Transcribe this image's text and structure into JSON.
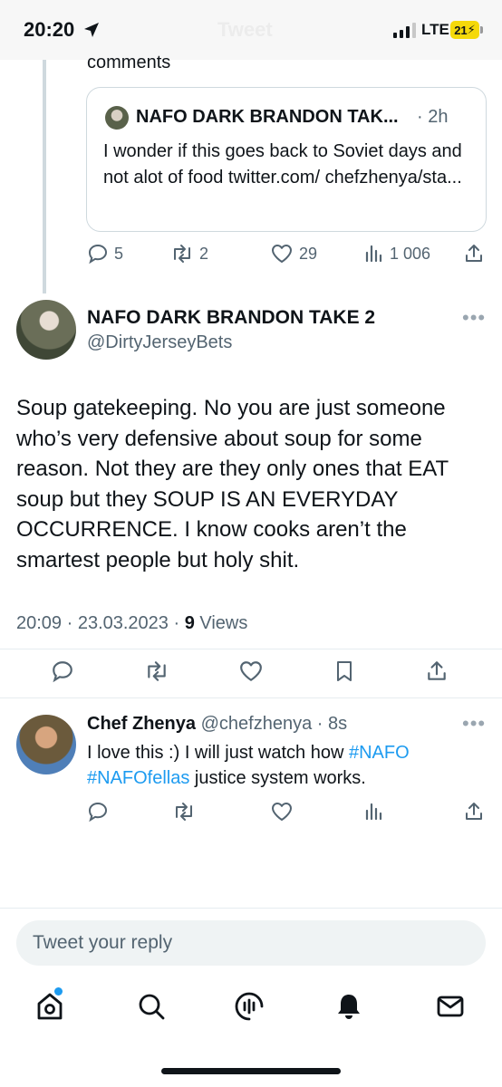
{
  "status_bar": {
    "time": "20:20",
    "ghost_title": "Tweet",
    "network": "LTE",
    "battery": "21"
  },
  "parent_tweet": {
    "tail_text": "comments",
    "quote": {
      "author_name": "NAFO DARK BRANDON TAK...",
      "time": "· 2h",
      "text": "I wonder if this goes back to Soviet days and not alot of food twitter.com/ chefzhenya/sta..."
    },
    "actions": {
      "replies": "5",
      "retweets": "2",
      "likes": "29",
      "views": "1 006"
    }
  },
  "main_tweet": {
    "author_name": "NAFO DARK BRANDON TAKE 2",
    "author_handle": "@DirtyJerseyBets",
    "more": "•••",
    "text": "Soup gatekeeping. No you are just someone who’s very defensive about soup for some reason. Not they are they only ones that EAT soup but they SOUP IS AN EVERYDAY OCCURRENCE. I know cooks aren’t the smartest people but holy shit.",
    "timestamp": "20:09 · 23.03.2023 · ",
    "views_count": "9",
    "views_label": " Views"
  },
  "reply_tweet": {
    "author_name": "Chef Zhenya",
    "author_handle": " @chefzhenya",
    "time": " · 8s",
    "more": "•••",
    "text_before": "I love this :) I will just watch how ",
    "hashtag1": "#NAFO",
    "hashtag2": "#NAFOfellas",
    "text_after": " justice system works."
  },
  "composer": {
    "placeholder": "Tweet your reply"
  },
  "icons": [
    "navigation-arrow-icon",
    "reply-icon",
    "retweet-icon",
    "like-icon",
    "views-icon",
    "share-icon",
    "bookmark-icon",
    "home-icon",
    "search-icon",
    "spaces-icon",
    "notifications-icon",
    "messages-icon"
  ],
  "colors": {
    "accent": "#1d9bf0",
    "secondary_text": "#536471",
    "battery": "#f5d90a"
  }
}
